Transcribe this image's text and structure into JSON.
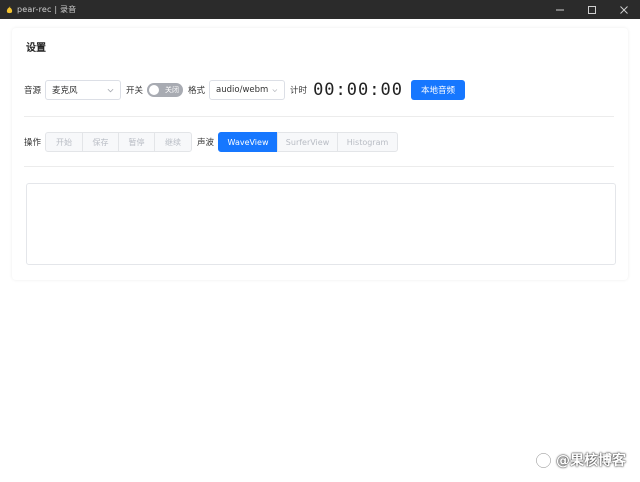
{
  "window": {
    "title": "pear-rec | 录音",
    "icon": "pear-app-icon"
  },
  "card": {
    "title": "设置"
  },
  "source": {
    "label": "音源",
    "selected": "麦克风"
  },
  "toggle": {
    "label": "开关",
    "state_text": "关闭"
  },
  "format": {
    "label": "格式",
    "selected": "audio/webm"
  },
  "timer": {
    "label": "计时",
    "value": "00:00:00"
  },
  "local_audio_button": "本地音频",
  "operations": {
    "label": "操作",
    "buttons": [
      "开始",
      "保存",
      "暂停",
      "继续"
    ]
  },
  "waveform": {
    "label": "声波",
    "options": [
      "WaveView",
      "SurferView",
      "Histogram"
    ],
    "selected": "WaveView"
  },
  "watermark": {
    "text": "@果核博客"
  },
  "colors": {
    "primary": "#1677ff",
    "titlebar": "#2b2b2b"
  }
}
